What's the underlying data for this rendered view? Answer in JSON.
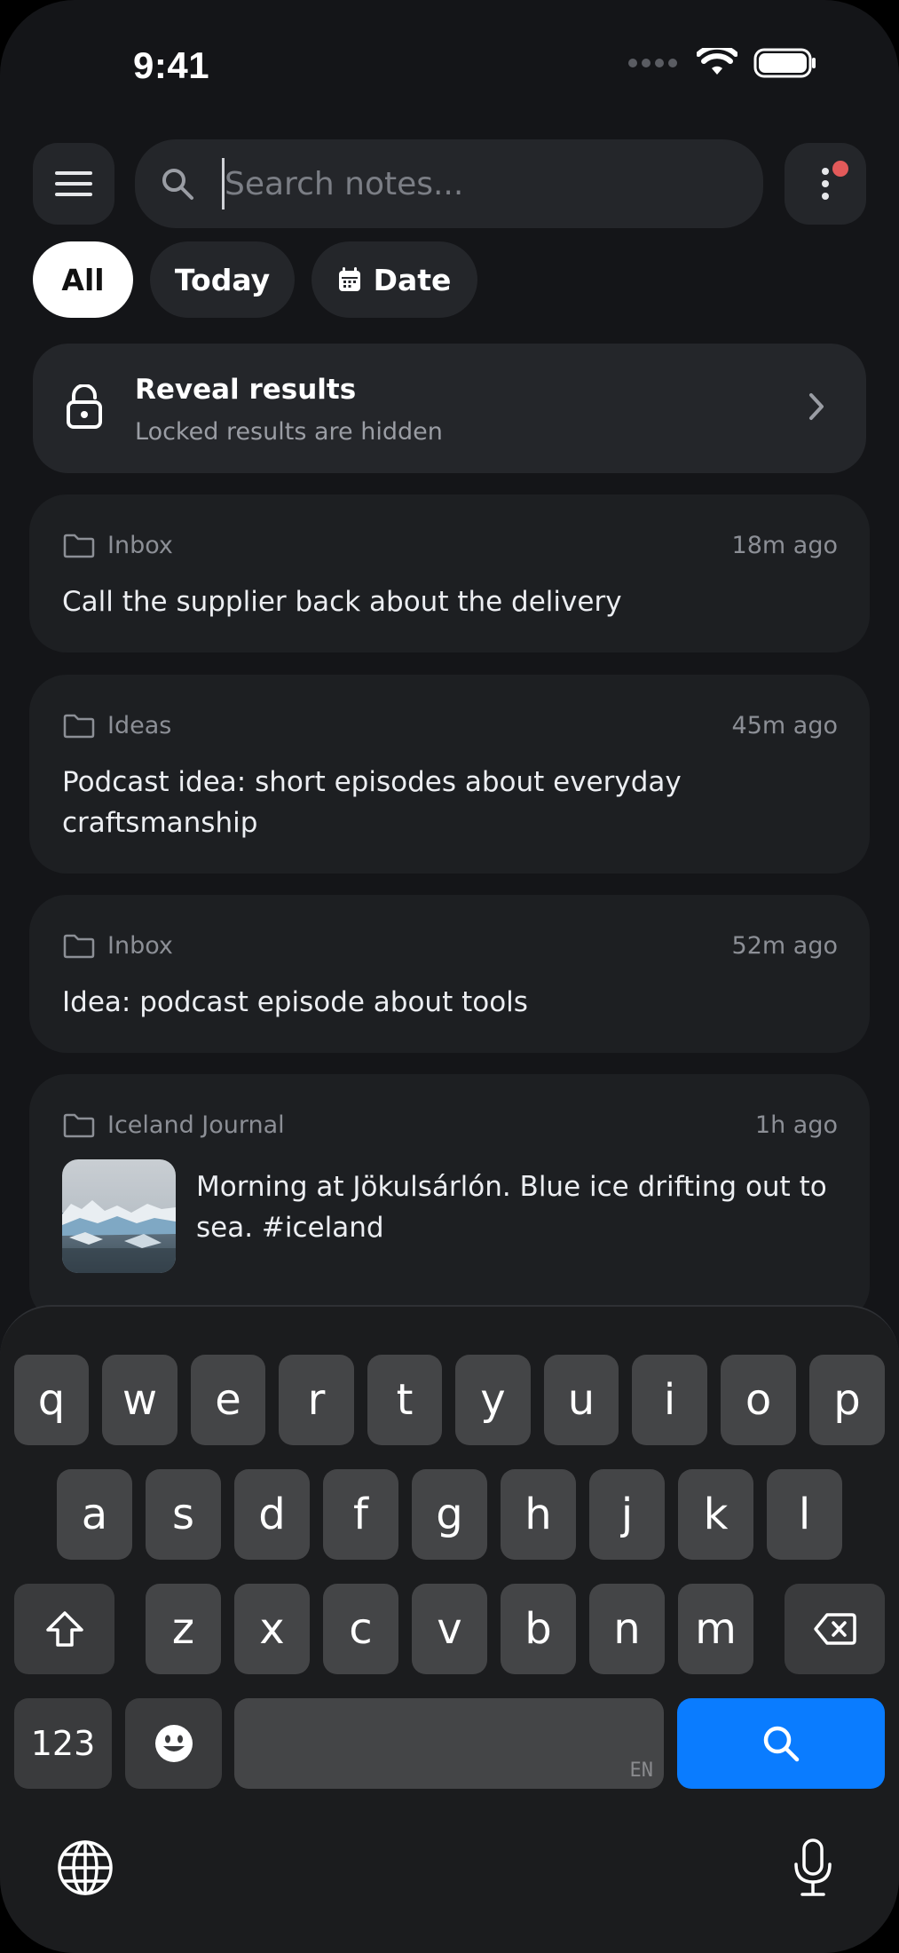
{
  "status_bar": {
    "time": "9:41"
  },
  "search": {
    "placeholder": "Search notes..."
  },
  "filters": {
    "all": "All",
    "today": "Today",
    "date": "Date"
  },
  "reveal": {
    "title": "Reveal results",
    "subtitle": "Locked results are hidden"
  },
  "notes": [
    {
      "folder": "Inbox",
      "time": "18m ago",
      "text": "Call the supplier back about the delivery"
    },
    {
      "folder": "Ideas",
      "time": "45m ago",
      "text": "Podcast idea: short episodes about everyday craftsmanship"
    },
    {
      "folder": "Inbox",
      "time": "52m ago",
      "text": "Idea: podcast episode about tools"
    },
    {
      "folder": "Iceland Journal",
      "time": "1h ago",
      "text": "Morning at Jökulsárlón. Blue ice drifting out to sea. #iceland"
    }
  ],
  "keyboard": {
    "row1": [
      "q",
      "w",
      "e",
      "r",
      "t",
      "y",
      "u",
      "i",
      "o",
      "p"
    ],
    "row2": [
      "a",
      "s",
      "d",
      "f",
      "g",
      "h",
      "j",
      "k",
      "l"
    ],
    "row3": [
      "z",
      "x",
      "c",
      "v",
      "b",
      "n",
      "m"
    ],
    "numbers_label": "123",
    "space_lang": "EN"
  },
  "colors": {
    "accent": "#0a7cff",
    "notification_dot": "#e35a5a",
    "background": "#141518",
    "card": "#24262a"
  }
}
